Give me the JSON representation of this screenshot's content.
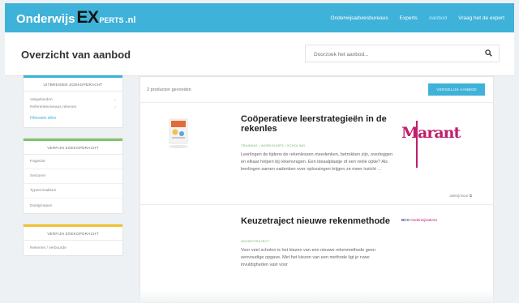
{
  "header": {
    "logo": {
      "part1": "Onderwijs",
      "part2": "EX",
      "part3": "PERTS",
      "part4": ".nl"
    },
    "nav": [
      {
        "label": "Onderwijsadviesbureaus",
        "active": false
      },
      {
        "label": "Experts",
        "active": false
      },
      {
        "label": "Aanbod",
        "active": true
      },
      {
        "label": "Vraag het de expert",
        "active": false
      }
    ]
  },
  "page": {
    "title": "Overzicht van aanbod",
    "search_placeholder": "Doorzoek het aanbod..."
  },
  "sidebar": {
    "panels": [
      {
        "heading": "UITBREIDEN ZOEKOPDRACHT",
        "items": [
          "Vakgebieden",
          "Referentieniveaus rekenen"
        ],
        "link": "Filtersets allen"
      },
      {
        "heading": "VERFIJN ZOEKOPDRACHT",
        "items": [
          "PageDot",
          "Sectoren",
          "Typeen/vakken",
          "Doelgroepen"
        ]
      },
      {
        "heading": "VERFIJN ZOEKOPDRACHT",
        "items": [
          "Rekenen / verbuurde"
        ]
      }
    ]
  },
  "results": {
    "count_text": "2 producten gevonden",
    "cta_label": "VERGELIJK AANBOD"
  },
  "products": [
    {
      "title": "Coöperatieve leerstrategieën in de rekenles",
      "tags": "TRAINING / WORKSHOPS / SCHOLING",
      "description": "Leerlingen de tijdens de rekenlessen meedenken, betrokken zijn, overleggen en elkaar helpen bij rekenvragen. Een ideaalplaatje of een reële optie? Als leerlingen samen nadenken over oplossingen krijgen ze meer inzicht ...",
      "brand": "Marant",
      "meta": "adecijnsuur"
    },
    {
      "title": "Keuzetraject nieuwe rekenmethode",
      "tags": "ADVIESTRAJECT",
      "description": "Voor veel scholen is het kiezen van een nieuwe rekenmethode geen eenvoudige opgave. Met het kiezen van een methode ligt je ruwe invuldigheden vast voor",
      "brand_prefix": "BCO",
      "brand_name": "Onderwijsadvies"
    }
  ],
  "colors": {
    "accent": "#3fb2d9",
    "green": "#7dc36b",
    "yellow": "#f2c231",
    "brand": "#c01f6d"
  }
}
